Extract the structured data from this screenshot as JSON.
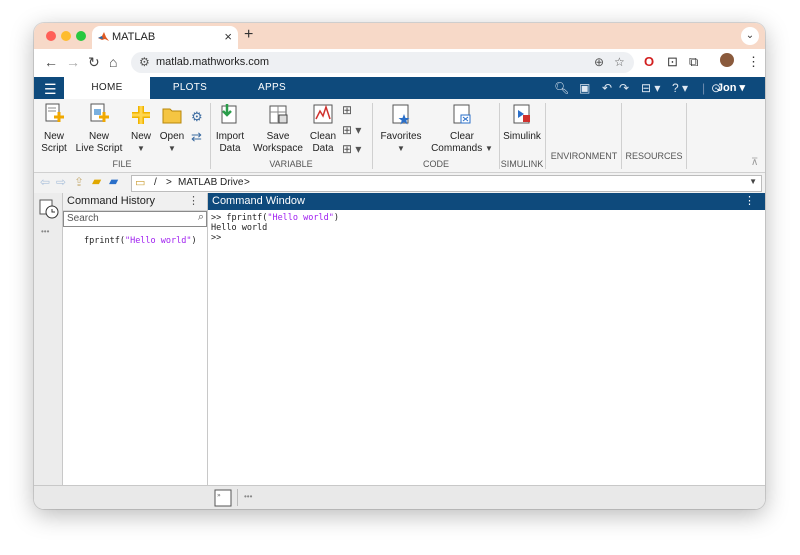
{
  "browser": {
    "tab_title": "MATLAB",
    "close_glyph": "×",
    "newtab_glyph": "+",
    "url": "matlab.mathworks.com",
    "colors": {
      "tab_strip": "#f7d9c8",
      "close": "#ff5f57",
      "minimize": "#febc2e",
      "zoom": "#28c840"
    },
    "icons": [
      "back-icon",
      "forward-icon",
      "reload-icon",
      "home-icon",
      "site-settings-icon",
      "zoom-icon",
      "bookmark-star-icon",
      "opera-extension-icon",
      "screen-capture-icon",
      "extensions-icon",
      "profile-avatar-icon",
      "more-menu-icon"
    ]
  },
  "header": {
    "tabs": [
      {
        "label": "HOME",
        "active": true
      },
      {
        "label": "PLOTS",
        "active": false
      },
      {
        "label": "APPS",
        "active": false
      }
    ],
    "user": "Jon",
    "brand_color": "#0e4a7c",
    "icons": [
      "search-icon",
      "save-icon",
      "undo-icon",
      "redo-icon",
      "switch-windows-icon",
      "help-icon",
      "community-icon"
    ]
  },
  "ribbon": {
    "file": {
      "group": "FILE",
      "new_script": [
        "New",
        "Script"
      ],
      "new_live_script": [
        "New",
        "Live Script"
      ],
      "new": "New",
      "open": "Open"
    },
    "variable": {
      "group": "VARIABLE",
      "import_data": [
        "Import",
        "Data"
      ],
      "save_workspace": [
        "Save",
        "Workspace"
      ],
      "clean_data": [
        "Clean",
        "Data"
      ]
    },
    "code": {
      "group": "CODE",
      "favorites": "Favorites",
      "clear_commands": [
        "Clear",
        "Commands"
      ]
    },
    "simulink": {
      "group": "SIMULINK",
      "simulink": "Simulink"
    },
    "environment": "ENVIRONMENT",
    "resources": "RESOURCES"
  },
  "path": {
    "root": "/",
    "separator": ">",
    "folder": "MATLAB Drive"
  },
  "history": {
    "title": "Command History",
    "search_placeholder": "Search",
    "entries": [
      {
        "cmd": "fprintf(",
        "str": "\"Hello world\"",
        "end": ")"
      }
    ]
  },
  "command_window": {
    "title": "Command Window",
    "prompt": ">>",
    "input_cmd": "fprintf(",
    "input_str": "\"Hello world\"",
    "input_end": ")",
    "output": "Hello world",
    "string_color": "#a020f0"
  },
  "bottom": {
    "ellipsis": "•••"
  }
}
